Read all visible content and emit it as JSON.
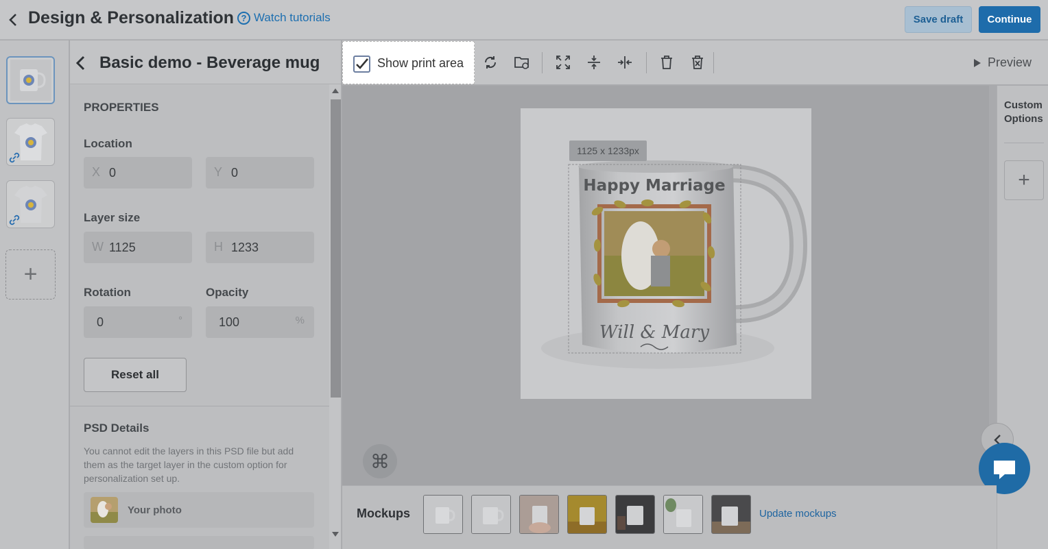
{
  "header": {
    "title": "Design & Personalization",
    "tutorials_label": "Watch tutorials",
    "help_icon_glyph": "?",
    "save_draft_label": "Save draft",
    "continue_label": "Continue"
  },
  "thumbnails": {
    "items": [
      {
        "name": "mug-thumbnail",
        "active": true,
        "linked": false
      },
      {
        "name": "tshirt-white-thumbnail",
        "active": false,
        "linked": true
      },
      {
        "name": "tshirt-gray-thumbnail",
        "active": false,
        "linked": true
      }
    ],
    "add_glyph": "+"
  },
  "properties": {
    "product_title": "Basic demo - Beverage mug",
    "section_title": "PROPERTIES",
    "location_label": "Location",
    "x_prefix": "X",
    "x_value": "0",
    "y_prefix": "Y",
    "y_value": "0",
    "layer_size_label": "Layer size",
    "w_prefix": "W",
    "w_value": "1125",
    "h_prefix": "H",
    "h_value": "1233",
    "rotation_label": "Rotation",
    "rotation_value": "0",
    "rotation_unit": "°",
    "opacity_label": "Opacity",
    "opacity_value": "100",
    "opacity_unit": "%",
    "reset_label": "Reset all",
    "psd_title": "PSD Details",
    "psd_description": "You cannot edit the layers in this PSD file but add them as the target layer in the custom option for personalization set up.",
    "layers": [
      {
        "name": "Your photo"
      }
    ]
  },
  "toolbar": {
    "show_print_area_label": "Show print area",
    "show_print_area_checked": true,
    "tools": [
      "rotate-icon",
      "replace-folder-icon",
      "expand-icon",
      "align-vertical-center-icon",
      "align-horizontal-center-icon",
      "delete-icon",
      "clear-layer-icon"
    ],
    "preview_label": "Preview"
  },
  "canvas": {
    "dimension_label": "1125 x 1233px",
    "mug_heading": "Happy Marriage",
    "mug_names": "Will & Mary",
    "shortcut_glyph": "⌘"
  },
  "right_panel": {
    "custom_options_line1": "Custom",
    "custom_options_line2": "Options",
    "add_glyph": "+"
  },
  "mockups": {
    "label": "Mockups",
    "items": [
      "mockup-plain-left",
      "mockup-plain-right",
      "mockup-hand-held",
      "mockup-yellow-table",
      "mockup-dark-scene",
      "mockup-plant",
      "mockup-table-setting"
    ],
    "update_label": "Update mockups"
  },
  "colors": {
    "accent": "#1e6cab",
    "link": "#1d6fb0",
    "overlay_gray": "#a9aaad"
  }
}
